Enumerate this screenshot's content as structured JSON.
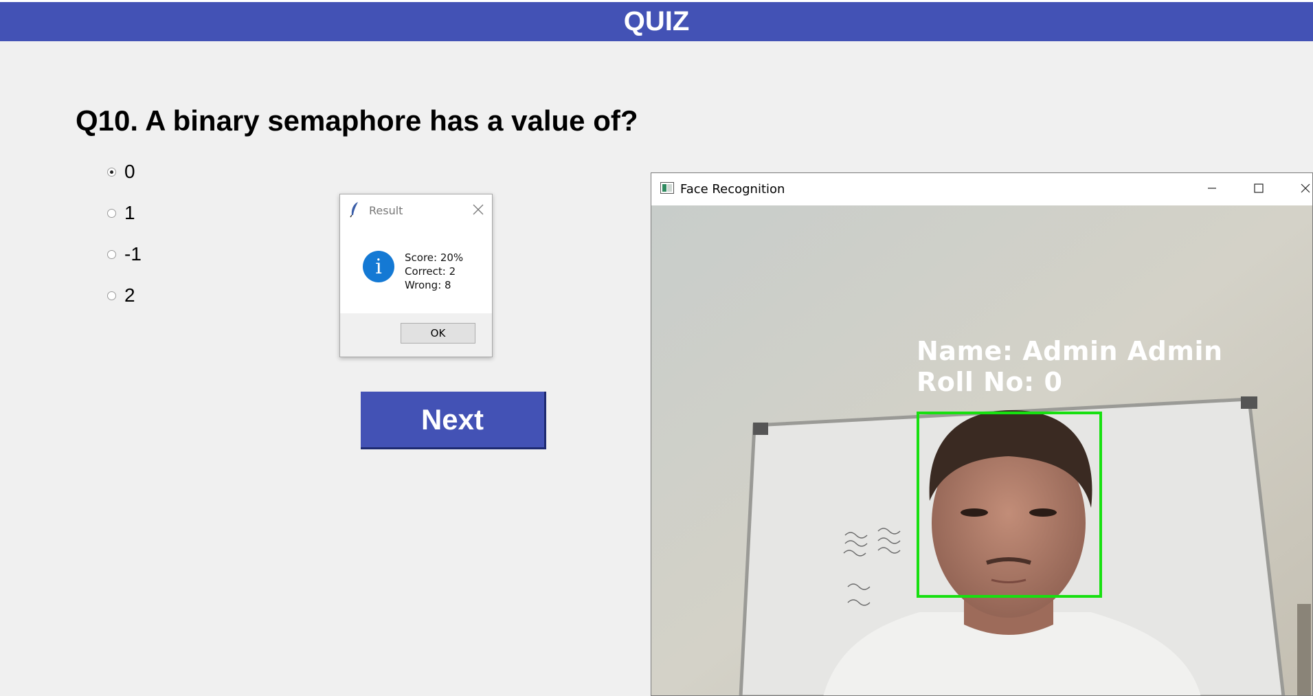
{
  "header": {
    "title": "QUIZ"
  },
  "question": {
    "text": "Q10. A binary semaphore has a value of?"
  },
  "options": [
    {
      "label": "0",
      "selected": true
    },
    {
      "label": "1",
      "selected": false
    },
    {
      "label": "-1",
      "selected": false
    },
    {
      "label": "2",
      "selected": false
    }
  ],
  "next_button": {
    "label": "Next"
  },
  "result_dialog": {
    "title": "Result",
    "icon": "info-icon",
    "lines": [
      "Score: 20%",
      "Correct: 2",
      "Wrong: 8"
    ],
    "ok_label": "OK"
  },
  "camera_window": {
    "title": "Face Recognition",
    "overlay_name": "Name: Admin Admin",
    "overlay_roll": "Roll No: 0"
  },
  "colors": {
    "accent": "#4352b5",
    "face_box": "#17e010",
    "info_icon": "#1479d4"
  }
}
